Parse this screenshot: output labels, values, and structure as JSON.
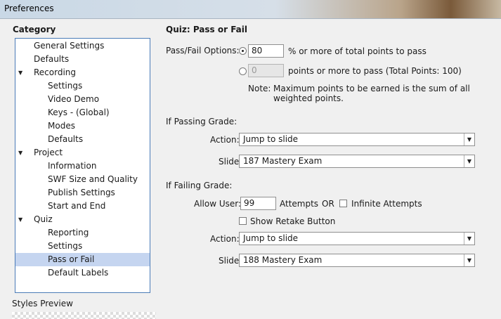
{
  "window": {
    "title": "Preferences"
  },
  "sidebar": {
    "heading": "Category",
    "items": [
      {
        "label": "General Settings",
        "level": 0,
        "expander": false,
        "selected": false
      },
      {
        "label": "Defaults",
        "level": 0,
        "expander": false,
        "selected": false
      },
      {
        "label": "Recording",
        "level": 0,
        "expander": true,
        "selected": false
      },
      {
        "label": "Settings",
        "level": 1,
        "expander": false,
        "selected": false
      },
      {
        "label": "Video Demo",
        "level": 1,
        "expander": false,
        "selected": false
      },
      {
        "label": "Keys - (Global)",
        "level": 1,
        "expander": false,
        "selected": false
      },
      {
        "label": "Modes",
        "level": 1,
        "expander": false,
        "selected": false
      },
      {
        "label": "Defaults",
        "level": 1,
        "expander": false,
        "selected": false
      },
      {
        "label": "Project",
        "level": 0,
        "expander": true,
        "selected": false
      },
      {
        "label": "Information",
        "level": 1,
        "expander": false,
        "selected": false
      },
      {
        "label": "SWF Size and Quality",
        "level": 1,
        "expander": false,
        "selected": false
      },
      {
        "label": "Publish Settings",
        "level": 1,
        "expander": false,
        "selected": false
      },
      {
        "label": "Start and End",
        "level": 1,
        "expander": false,
        "selected": false
      },
      {
        "label": "Quiz",
        "level": 0,
        "expander": true,
        "selected": false
      },
      {
        "label": "Reporting",
        "level": 1,
        "expander": false,
        "selected": false
      },
      {
        "label": "Settings",
        "level": 1,
        "expander": false,
        "selected": false
      },
      {
        "label": "Pass or Fail",
        "level": 1,
        "expander": false,
        "selected": true
      },
      {
        "label": "Default Labels",
        "level": 1,
        "expander": false,
        "selected": false
      }
    ],
    "expander_glyph": "▼",
    "styles_preview": "Styles Preview"
  },
  "main": {
    "title": "Quiz: Pass or Fail",
    "pass_fail_label": "Pass/Fail Options:",
    "percent_value": "80",
    "percent_suffix": "% or more of total points to pass",
    "points_value": "0",
    "points_suffix": "points or more to pass (Total Points: 100)",
    "note_label": "Note:",
    "note_line1": "Maximum points to be earned is the sum of all",
    "note_line2": "weighted points.",
    "passing_heading": "If Passing Grade:",
    "passing_action_label": "Action:",
    "passing_action_value": "Jump to slide",
    "passing_slide_label": "Slide",
    "passing_slide_value": "187 Mastery Exam",
    "failing_heading": "If Failing Grade:",
    "allow_user_label": "Allow User:",
    "attempts_value": "99",
    "attempts_label": "Attempts",
    "or_label": "OR",
    "infinite_attempts_label": "Infinite Attempts",
    "show_retake_label": "Show Retake Button",
    "failing_action_label": "Action:",
    "failing_action_value": "Jump to slide",
    "failing_slide_label": "Slide",
    "failing_slide_value": "188 Mastery Exam",
    "caret_glyph": "▼"
  }
}
